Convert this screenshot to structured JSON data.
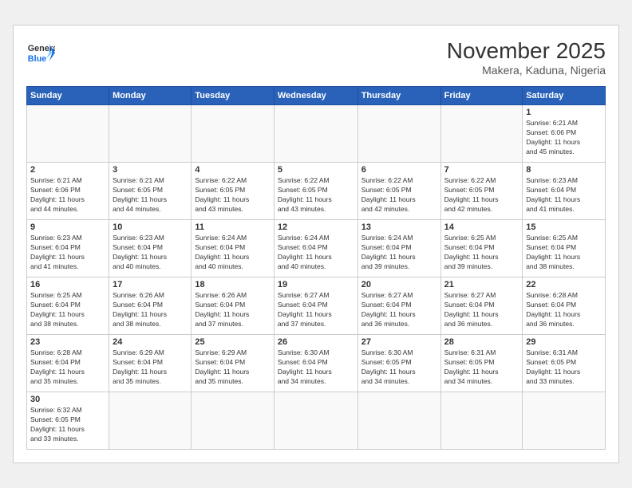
{
  "header": {
    "logo_general": "General",
    "logo_blue": "Blue",
    "month_title": "November 2025",
    "subtitle": "Makera, Kaduna, Nigeria"
  },
  "days_of_week": [
    "Sunday",
    "Monday",
    "Tuesday",
    "Wednesday",
    "Thursday",
    "Friday",
    "Saturday"
  ],
  "weeks": [
    [
      {
        "day": "",
        "info": ""
      },
      {
        "day": "",
        "info": ""
      },
      {
        "day": "",
        "info": ""
      },
      {
        "day": "",
        "info": ""
      },
      {
        "day": "",
        "info": ""
      },
      {
        "day": "",
        "info": ""
      },
      {
        "day": "1",
        "info": "Sunrise: 6:21 AM\nSunset: 6:06 PM\nDaylight: 11 hours\nand 45 minutes."
      }
    ],
    [
      {
        "day": "2",
        "info": "Sunrise: 6:21 AM\nSunset: 6:06 PM\nDaylight: 11 hours\nand 44 minutes."
      },
      {
        "day": "3",
        "info": "Sunrise: 6:21 AM\nSunset: 6:05 PM\nDaylight: 11 hours\nand 44 minutes."
      },
      {
        "day": "4",
        "info": "Sunrise: 6:22 AM\nSunset: 6:05 PM\nDaylight: 11 hours\nand 43 minutes."
      },
      {
        "day": "5",
        "info": "Sunrise: 6:22 AM\nSunset: 6:05 PM\nDaylight: 11 hours\nand 43 minutes."
      },
      {
        "day": "6",
        "info": "Sunrise: 6:22 AM\nSunset: 6:05 PM\nDaylight: 11 hours\nand 42 minutes."
      },
      {
        "day": "7",
        "info": "Sunrise: 6:22 AM\nSunset: 6:05 PM\nDaylight: 11 hours\nand 42 minutes."
      },
      {
        "day": "8",
        "info": "Sunrise: 6:23 AM\nSunset: 6:04 PM\nDaylight: 11 hours\nand 41 minutes."
      }
    ],
    [
      {
        "day": "9",
        "info": "Sunrise: 6:23 AM\nSunset: 6:04 PM\nDaylight: 11 hours\nand 41 minutes."
      },
      {
        "day": "10",
        "info": "Sunrise: 6:23 AM\nSunset: 6:04 PM\nDaylight: 11 hours\nand 40 minutes."
      },
      {
        "day": "11",
        "info": "Sunrise: 6:24 AM\nSunset: 6:04 PM\nDaylight: 11 hours\nand 40 minutes."
      },
      {
        "day": "12",
        "info": "Sunrise: 6:24 AM\nSunset: 6:04 PM\nDaylight: 11 hours\nand 40 minutes."
      },
      {
        "day": "13",
        "info": "Sunrise: 6:24 AM\nSunset: 6:04 PM\nDaylight: 11 hours\nand 39 minutes."
      },
      {
        "day": "14",
        "info": "Sunrise: 6:25 AM\nSunset: 6:04 PM\nDaylight: 11 hours\nand 39 minutes."
      },
      {
        "day": "15",
        "info": "Sunrise: 6:25 AM\nSunset: 6:04 PM\nDaylight: 11 hours\nand 38 minutes."
      }
    ],
    [
      {
        "day": "16",
        "info": "Sunrise: 6:25 AM\nSunset: 6:04 PM\nDaylight: 11 hours\nand 38 minutes."
      },
      {
        "day": "17",
        "info": "Sunrise: 6:26 AM\nSunset: 6:04 PM\nDaylight: 11 hours\nand 38 minutes."
      },
      {
        "day": "18",
        "info": "Sunrise: 6:26 AM\nSunset: 6:04 PM\nDaylight: 11 hours\nand 37 minutes."
      },
      {
        "day": "19",
        "info": "Sunrise: 6:27 AM\nSunset: 6:04 PM\nDaylight: 11 hours\nand 37 minutes."
      },
      {
        "day": "20",
        "info": "Sunrise: 6:27 AM\nSunset: 6:04 PM\nDaylight: 11 hours\nand 36 minutes."
      },
      {
        "day": "21",
        "info": "Sunrise: 6:27 AM\nSunset: 6:04 PM\nDaylight: 11 hours\nand 36 minutes."
      },
      {
        "day": "22",
        "info": "Sunrise: 6:28 AM\nSunset: 6:04 PM\nDaylight: 11 hours\nand 36 minutes."
      }
    ],
    [
      {
        "day": "23",
        "info": "Sunrise: 6:28 AM\nSunset: 6:04 PM\nDaylight: 11 hours\nand 35 minutes."
      },
      {
        "day": "24",
        "info": "Sunrise: 6:29 AM\nSunset: 6:04 PM\nDaylight: 11 hours\nand 35 minutes."
      },
      {
        "day": "25",
        "info": "Sunrise: 6:29 AM\nSunset: 6:04 PM\nDaylight: 11 hours\nand 35 minutes."
      },
      {
        "day": "26",
        "info": "Sunrise: 6:30 AM\nSunset: 6:04 PM\nDaylight: 11 hours\nand 34 minutes."
      },
      {
        "day": "27",
        "info": "Sunrise: 6:30 AM\nSunset: 6:05 PM\nDaylight: 11 hours\nand 34 minutes."
      },
      {
        "day": "28",
        "info": "Sunrise: 6:31 AM\nSunset: 6:05 PM\nDaylight: 11 hours\nand 34 minutes."
      },
      {
        "day": "29",
        "info": "Sunrise: 6:31 AM\nSunset: 6:05 PM\nDaylight: 11 hours\nand 33 minutes."
      }
    ],
    [
      {
        "day": "30",
        "info": "Sunrise: 6:32 AM\nSunset: 6:05 PM\nDaylight: 11 hours\nand 33 minutes."
      },
      {
        "day": "",
        "info": ""
      },
      {
        "day": "",
        "info": ""
      },
      {
        "day": "",
        "info": ""
      },
      {
        "day": "",
        "info": ""
      },
      {
        "day": "",
        "info": ""
      },
      {
        "day": "",
        "info": ""
      }
    ]
  ]
}
